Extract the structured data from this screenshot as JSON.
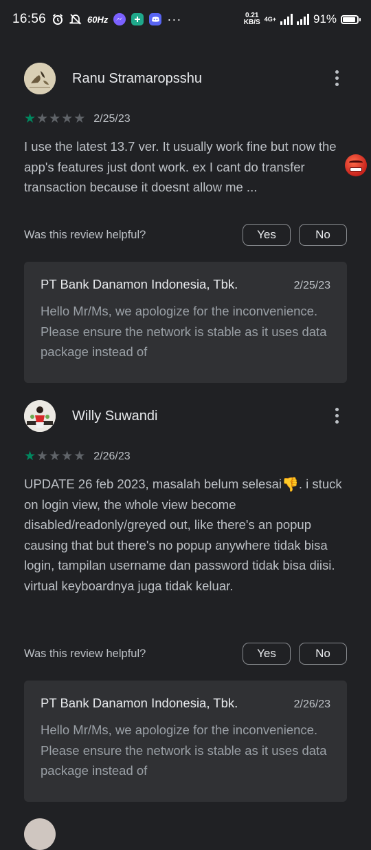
{
  "status_bar": {
    "time": "16:56",
    "refresh_rate": "60Hz",
    "net_speed_value": "0.21",
    "net_speed_unit": "KB/S",
    "network_type": "4G+",
    "battery_percent": "91%",
    "battery_level": 0.91,
    "more_notifications": "···",
    "icons": [
      "alarm-icon",
      "mute-icon",
      "messenger-icon",
      "plus-app-icon",
      "discord-icon"
    ]
  },
  "reviews": [
    {
      "reviewer": "Ranu Stramaropsshu",
      "rating": 1,
      "max_rating": 5,
      "date": "2/25/23",
      "text": "I use the latest 13.7 ver. It usually work fine but now the app's features just dont work. ex I cant do transfer transaction because it doesnt allow me ...",
      "helpful_question": "Was this review helpful?",
      "yes_label": "Yes",
      "no_label": "No",
      "reply": {
        "developer": "PT Bank Danamon Indonesia, Tbk.",
        "date": "2/25/23",
        "text": "Hello Mr/Ms, we apologize for the inconvenience. Please ensure the network is stable as it uses data package instead of"
      }
    },
    {
      "reviewer": "Willy Suwandi",
      "rating": 1,
      "max_rating": 5,
      "date": "2/26/23",
      "text_before_emoji": "UPDATE 26 feb 2023, masalah belum selesai",
      "emoji": "👎",
      "text_after_emoji": ". i stuck on login view, the whole view become disabled/readonly/greyed out, like there's an popup causing that but there's no popup anywhere tidak bisa login, tampilan username dan password tidak bisa diisi. virtual keyboardnya juga tidak keluar.",
      "helpful_question": "Was this review helpful?",
      "yes_label": "Yes",
      "no_label": "No",
      "reply": {
        "developer": "PT Bank Danamon Indonesia, Tbk.",
        "date": "2/26/23",
        "text": "Hello Mr/Ms, we apologize for the inconvenience. Please ensure the network is stable as it uses data package instead of"
      }
    }
  ],
  "colors": {
    "background": "#202124",
    "card": "#303134",
    "star_filled": "#01875f",
    "star_empty": "#5f6368",
    "text_primary": "#e8eaed",
    "text_secondary": "#bdc1c6"
  }
}
